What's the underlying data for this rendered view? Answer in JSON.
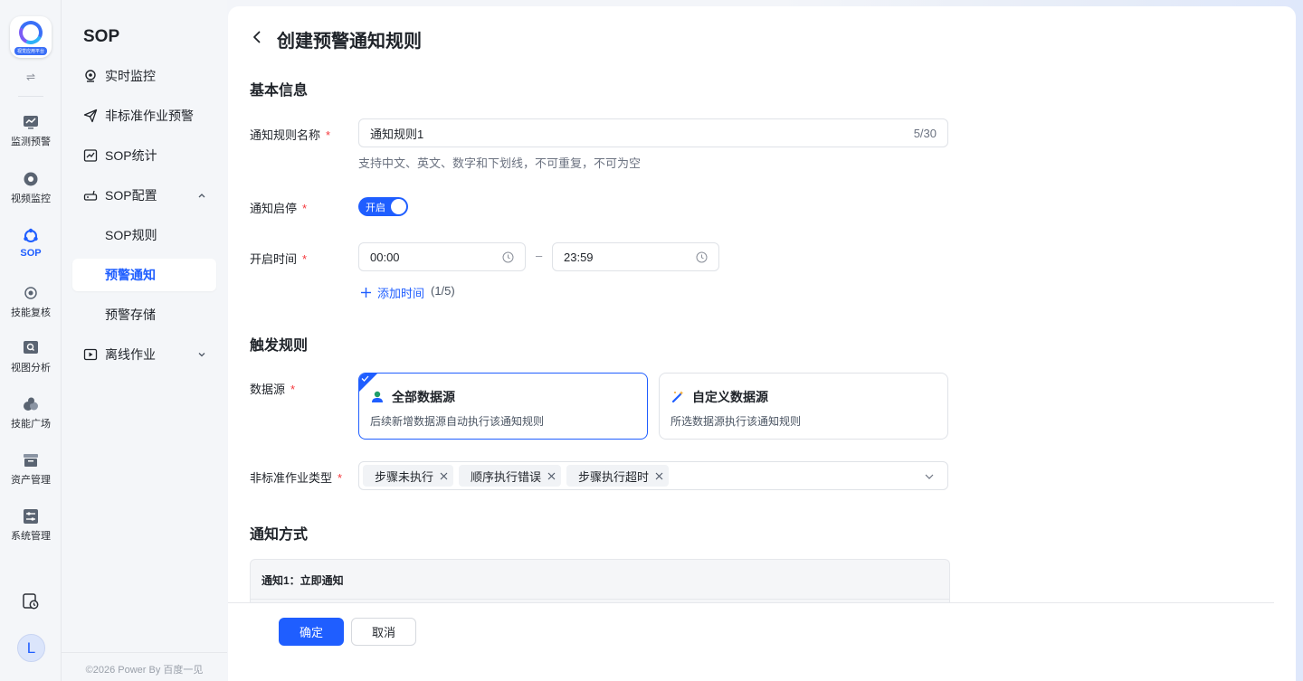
{
  "rail": {
    "logo_text": "视觉应用平台",
    "items": [
      {
        "label": "监测预警",
        "icon": "monitor-chart-icon"
      },
      {
        "label": "视频监控",
        "icon": "camera-icon"
      },
      {
        "label": "SOP",
        "icon": "sop-icon"
      },
      {
        "label": "技能复核",
        "icon": "target-icon"
      },
      {
        "label": "视图分析",
        "icon": "image-search-icon"
      },
      {
        "label": "技能广场",
        "icon": "bubbles-icon"
      },
      {
        "label": "资产管理",
        "icon": "archive-icon"
      },
      {
        "label": "系统管理",
        "icon": "sliders-icon"
      }
    ],
    "avatar_letter": "L"
  },
  "sidebar": {
    "title": "SOP",
    "items": [
      {
        "label": "实时监控"
      },
      {
        "label": "非标准作业预警"
      },
      {
        "label": "SOP统计"
      },
      {
        "label": "SOP配置"
      },
      {
        "label": "SOP规则"
      },
      {
        "label": "预警通知"
      },
      {
        "label": "预警存储"
      },
      {
        "label": "离线作业"
      }
    ],
    "footer": "©2026 Power By 百度一见"
  },
  "page": {
    "title": "创建预警通知规则",
    "basic_info": "基本信息",
    "rule_name_label": "通知规则名称",
    "rule_name_value": "通知规则1",
    "rule_name_count": "5/30",
    "rule_name_hint": "支持中文、英文、数字和下划线，不可重复，不可为空",
    "toggle_label": "通知启停",
    "toggle_text": "开启",
    "time_label": "开启时间",
    "time_start": "00:00",
    "time_dash": "–",
    "time_end": "23:59",
    "add_time": "添加时间",
    "add_time_count": "(1/5)",
    "trigger_rules": "触发规则",
    "datasource_label": "数据源",
    "datasource_all_title": "全部数据源",
    "datasource_all_desc": "后续新增数据源自动执行该通知规则",
    "datasource_custom_title": "自定义数据源",
    "datasource_custom_desc": "所选数据源执行该通知规则",
    "job_type_label": "非标准作业类型",
    "tags": [
      "步骤未执行",
      "顺序执行错误",
      "步骤执行超时"
    ],
    "notice_method": "通知方式",
    "notice_item": "通知1：立即通知",
    "confirm": "确定",
    "cancel": "取消"
  },
  "colors": {
    "primary": "#1f5eff",
    "required": "#f5383c"
  }
}
